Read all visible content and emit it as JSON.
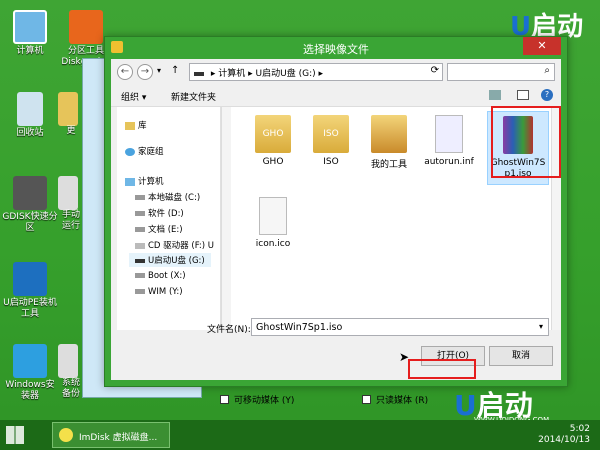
{
  "desktop": {
    "icons_left": [
      "计算机",
      "回收站",
      "GDISK快速分区",
      "U启动PE装机工具",
      "Windows安装器"
    ],
    "icons_col2": [
      "分区工具Diskgenius",
      "手动运行",
      "系统备份"
    ],
    "partial_col2": [
      "更"
    ],
    "brand": "启动"
  },
  "dialog": {
    "title": "选择映像文件",
    "close": "✕",
    "path": [
      "计算机",
      "U启动U盘 (G:)"
    ],
    "toolbar": {
      "organize": "组织 ▾",
      "new_folder": "新建文件夹"
    },
    "nav": {
      "items": [
        "库",
        "家庭组",
        "计算机",
        "本地磁盘 (C:)",
        "软件 (D:)",
        "文档 (E:)",
        "CD 驱动器 (F:) U",
        "U启动U盘 (G:)",
        "Boot (X:)",
        "WIM (Y:)"
      ]
    },
    "files": [
      "GHO",
      "ISO",
      "我的工具",
      "autorun.inf",
      "GhostWin7Sp1.iso",
      "icon.ico"
    ],
    "filename_label": "文件名(N):",
    "filename_value": "GhostWin7Sp1.iso",
    "open": "打开(O)",
    "cancel": "取消"
  },
  "bottom_checks": {
    "left": "可移动媒体 (Y)",
    "right": "只读媒体 (R)"
  },
  "taskbar": {
    "task": "ImDisk 虚拟磁盘...",
    "time": "5:02",
    "date": "2014/10/13"
  },
  "watermark": "WWW.UQIDONG.COM",
  "colors": {
    "desktop": "#3aa535",
    "taskbar": "#1c6a17",
    "highlight": "#e51d1d",
    "close": "#c7322b"
  }
}
